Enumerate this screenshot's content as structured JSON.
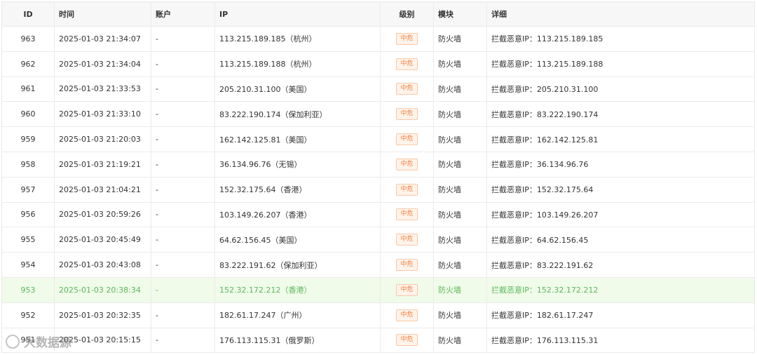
{
  "columns": {
    "id": "ID",
    "time": "时间",
    "account": "账户",
    "ip": "IP",
    "level": "级别",
    "module": "模块",
    "detail": "详细"
  },
  "rows": [
    {
      "id": "963",
      "time": "2025-01-03 21:34:07",
      "account": "-",
      "ip": "113.215.189.185（杭州）",
      "level": "中危",
      "module": "防火墙",
      "detail": "拦截恶意IP：113.215.189.185"
    },
    {
      "id": "962",
      "time": "2025-01-03 21:34:04",
      "account": "-",
      "ip": "113.215.189.188（杭州）",
      "level": "中危",
      "module": "防火墙",
      "detail": "拦截恶意IP：113.215.189.188"
    },
    {
      "id": "961",
      "time": "2025-01-03 21:33:53",
      "account": "-",
      "ip": "205.210.31.100（美国）",
      "level": "中危",
      "module": "防火墙",
      "detail": "拦截恶意IP：205.210.31.100"
    },
    {
      "id": "960",
      "time": "2025-01-03 21:33:10",
      "account": "-",
      "ip": "83.222.190.174（保加利亚）",
      "level": "中危",
      "module": "防火墙",
      "detail": "拦截恶意IP：83.222.190.174"
    },
    {
      "id": "959",
      "time": "2025-01-03 21:20:03",
      "account": "-",
      "ip": "162.142.125.81（美国）",
      "level": "中危",
      "module": "防火墙",
      "detail": "拦截恶意IP：162.142.125.81"
    },
    {
      "id": "958",
      "time": "2025-01-03 21:19:21",
      "account": "-",
      "ip": "36.134.96.76（无锡）",
      "level": "中危",
      "module": "防火墙",
      "detail": "拦截恶意IP：36.134.96.76"
    },
    {
      "id": "957",
      "time": "2025-01-03 21:04:21",
      "account": "-",
      "ip": "152.32.175.64（香港）",
      "level": "中危",
      "module": "防火墙",
      "detail": "拦截恶意IP：152.32.175.64"
    },
    {
      "id": "956",
      "time": "2025-01-03 20:59:26",
      "account": "-",
      "ip": "103.149.26.207（香港）",
      "level": "中危",
      "module": "防火墙",
      "detail": "拦截恶意IP：103.149.26.207"
    },
    {
      "id": "955",
      "time": "2025-01-03 20:45:49",
      "account": "-",
      "ip": "64.62.156.45（美国）",
      "level": "中危",
      "module": "防火墙",
      "detail": "拦截恶意IP：64.62.156.45"
    },
    {
      "id": "954",
      "time": "2025-01-03 20:43:08",
      "account": "-",
      "ip": "83.222.191.62（保加利亚）",
      "level": "中危",
      "module": "防火墙",
      "detail": "拦截恶意IP：83.222.191.62"
    },
    {
      "id": "953",
      "time": "2025-01-03 20:38:34",
      "account": "-",
      "ip": "152.32.172.212（香港）",
      "level": "中危",
      "module": "防火墙",
      "detail": "拦截恶意IP：152.32.172.212",
      "highlighted": true
    },
    {
      "id": "952",
      "time": "2025-01-03 20:32:35",
      "account": "-",
      "ip": "182.61.17.247（广州）",
      "level": "中危",
      "module": "防火墙",
      "detail": "拦截恶意IP：182.61.17.247"
    },
    {
      "id": "951",
      "time": "2025-01-03 20:15:15",
      "account": "-",
      "ip": "176.113.115.31（俄罗斯）",
      "level": "中危",
      "module": "防火墙",
      "detail": "拦截恶意IP：176.113.115.31"
    }
  ],
  "watermark": "大数据源",
  "colors": {
    "badge_text": "#f08040",
    "badge_bg": "#fff3ea",
    "highlight_row_bg": "#f0fbe9",
    "highlight_row_text": "#5cb85c"
  }
}
